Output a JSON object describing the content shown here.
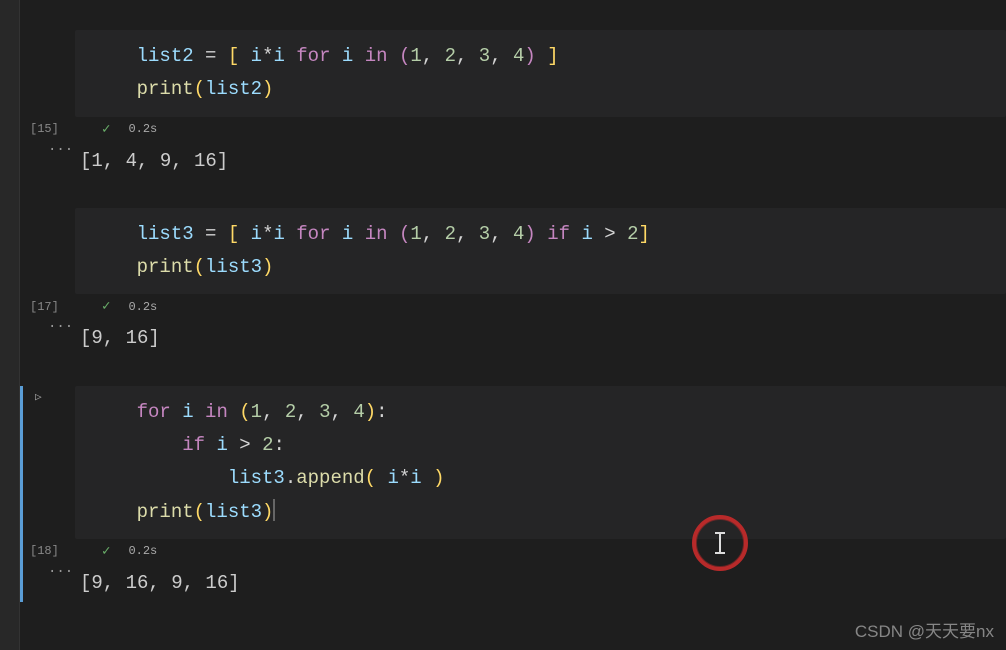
{
  "cells": [
    {
      "exec_label": "[15]",
      "duration": "0.2s",
      "code": {
        "line1": {
          "pre": "    ",
          "v": "list2",
          "eq": " = ",
          "ob": "[",
          "sp": " ",
          "ii1": "i",
          "mul": "*",
          "ii2": "i",
          "sp2": " ",
          "for": "for",
          "sp3": " ",
          "ivar": "i",
          "sp4": " ",
          "in": "in",
          "sp5": " ",
          "op": "(",
          "n1": "1",
          "c1": ", ",
          "n2": "2",
          "c2": ", ",
          "n3": "3",
          "c3": ", ",
          "n4": "4",
          "cp": ")",
          "sp6": " ",
          "cb": "]"
        },
        "line2": {
          "pre": "    ",
          "fn": "print",
          "op": "(",
          "arg": "list2",
          "cp": ")"
        }
      },
      "output": "[1, 4, 9, 16]"
    },
    {
      "exec_label": "[17]",
      "duration": "0.2s",
      "code": {
        "line1": {
          "pre": "    ",
          "v": "list3",
          "eq": " = ",
          "ob": "[",
          "sp": " ",
          "ii1": "i",
          "mul": "*",
          "ii2": "i",
          "sp2": " ",
          "for": "for",
          "sp3": " ",
          "ivar": "i",
          "sp4": " ",
          "in": "in",
          "sp5": " ",
          "op": "(",
          "n1": "1",
          "c1": ", ",
          "n2": "2",
          "c2": ", ",
          "n3": "3",
          "c3": ", ",
          "n4": "4",
          "cp": ")",
          "sp6": " ",
          "if": "if",
          "sp7": " ",
          "cvar": "i",
          "gt": " > ",
          "cn": "2",
          "cb": "]"
        },
        "line2": {
          "pre": "    ",
          "fn": "print",
          "op": "(",
          "arg": "list3",
          "cp": ")"
        }
      },
      "output": "[9, 16]"
    },
    {
      "exec_label": "[18]",
      "duration": "0.2s",
      "code": {
        "line1": {
          "pre": "    ",
          "for": "for",
          "sp": " ",
          "ivar": "i",
          "sp2": " ",
          "in": "in",
          "sp3": " ",
          "op": "(",
          "n1": "1",
          "c1": ", ",
          "n2": "2",
          "c2": ", ",
          "n3": "3",
          "c3": ", ",
          "n4": "4",
          "cp": ")",
          "colon": ":"
        },
        "line2": {
          "pre": "        ",
          "if": "if",
          "sp": " ",
          "ivar": "i",
          "gt": " > ",
          "n": "2",
          "colon": ":"
        },
        "line3": {
          "pre": "            ",
          "obj": "list3",
          "dot": ".",
          "fn": "append",
          "op": "(",
          "sp": " ",
          "a1": "i",
          "mul": "*",
          "a2": "i",
          "sp2": " ",
          "cp": ")"
        },
        "line4": {
          "pre": "    ",
          "fn": "print",
          "op": "(",
          "arg": "list3",
          "cp": ")"
        }
      },
      "output": "[9, 16, 9, 16]"
    }
  ],
  "watermark": "CSDN @天天要nx"
}
